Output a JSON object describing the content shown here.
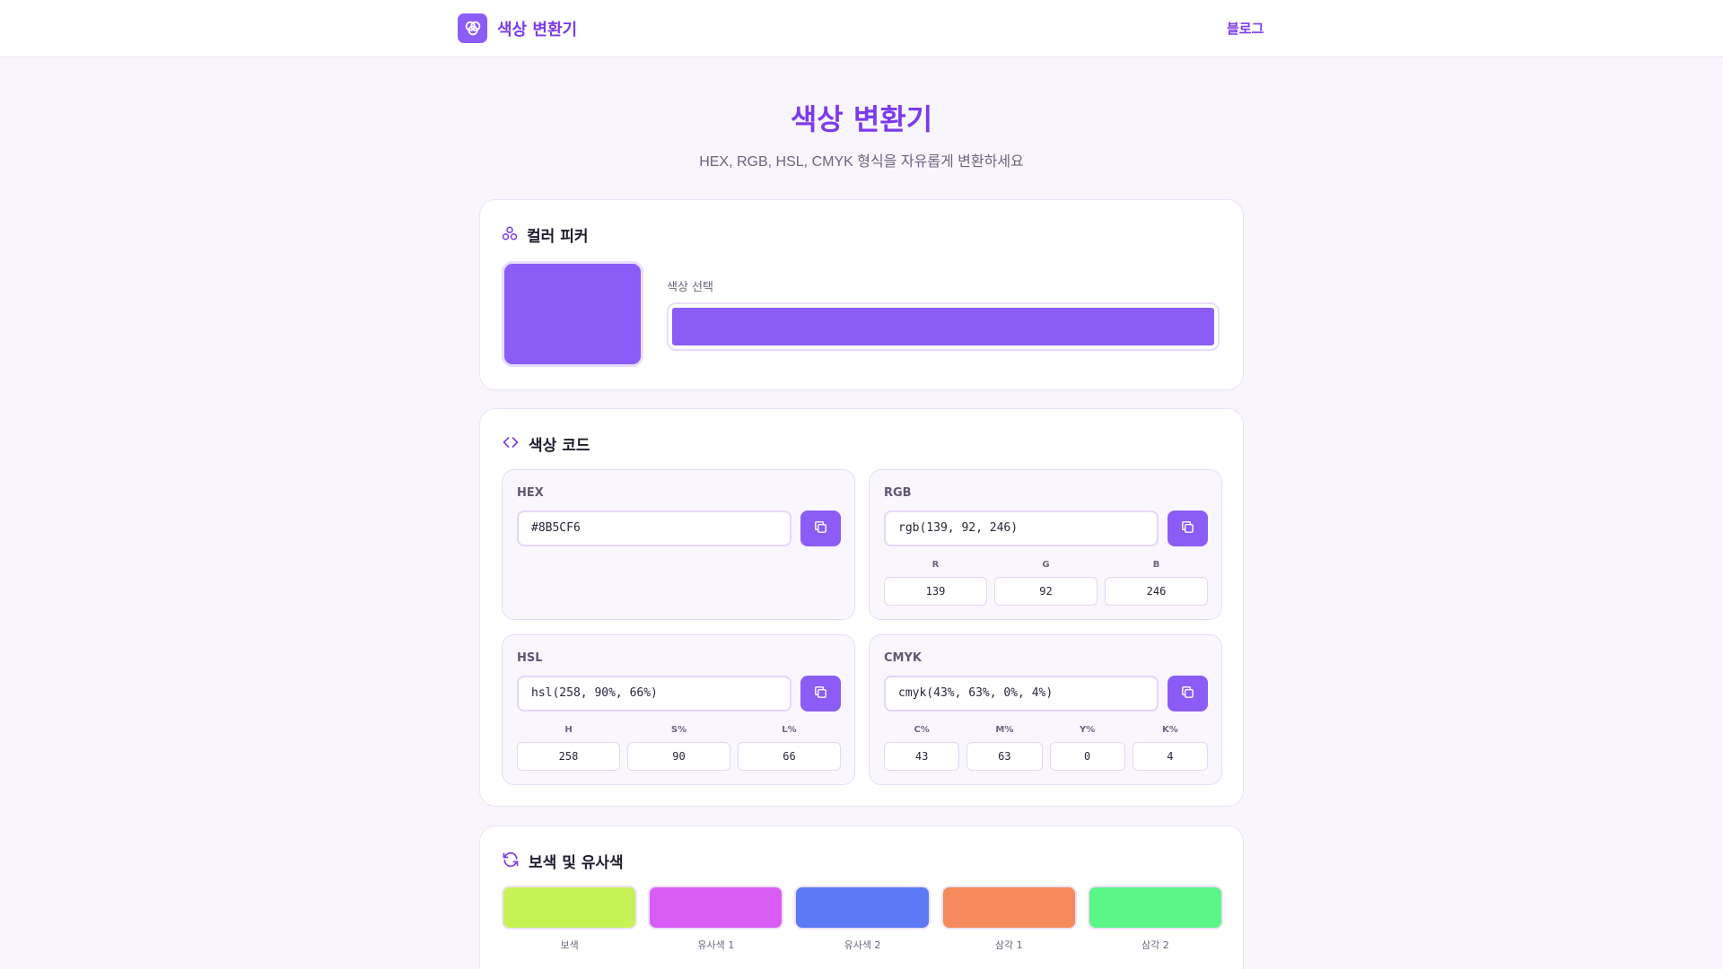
{
  "header": {
    "brand": "색상 변환기",
    "nav_blog": "블로그"
  },
  "hero": {
    "title": "색상 변환기",
    "subtitle": "HEX, RGB, HSL, CMYK 형식을 자유롭게 변환하세요"
  },
  "picker": {
    "title": "컬러 피커",
    "label": "색상 선택",
    "color": "#8b5cf6"
  },
  "codes": {
    "title": "색상 코드",
    "hex": {
      "label": "HEX",
      "value": "#8B5CF6"
    },
    "rgb": {
      "label": "RGB",
      "value": "rgb(139, 92, 246)",
      "channels": [
        {
          "label": "R",
          "value": "139"
        },
        {
          "label": "G",
          "value": "92"
        },
        {
          "label": "B",
          "value": "246"
        }
      ]
    },
    "hsl": {
      "label": "HSL",
      "value": "hsl(258, 90%, 66%)",
      "channels": [
        {
          "label": "H",
          "value": "258"
        },
        {
          "label": "S%",
          "value": "90"
        },
        {
          "label": "L%",
          "value": "66"
        }
      ]
    },
    "cmyk": {
      "label": "CMYK",
      "value": "cmyk(43%, 63%, 0%, 4%)",
      "channels": [
        {
          "label": "C%",
          "value": "43"
        },
        {
          "label": "M%",
          "value": "63"
        },
        {
          "label": "Y%",
          "value": "0"
        },
        {
          "label": "K%",
          "value": "4"
        }
      ]
    }
  },
  "harmony": {
    "title": "보색 및 유사색",
    "swatches": [
      {
        "name": "보색",
        "color": "#c6f255"
      },
      {
        "name": "유사색 1",
        "color": "#d95cf5"
      },
      {
        "name": "유사색 2",
        "color": "#5c7af5"
      },
      {
        "name": "삼각 1",
        "color": "#f58a5c"
      },
      {
        "name": "삼각 2",
        "color": "#5cf588"
      }
    ]
  },
  "icons": {
    "brand": "palette-icon",
    "picker": "palette-icon",
    "codes": "code-icon",
    "harmony": "refresh-icon",
    "copy": "copy-icon"
  },
  "colors": {
    "accent": "#8b5cf6",
    "accent_dark": "#7c3aed",
    "background": "#f9f5fd"
  }
}
